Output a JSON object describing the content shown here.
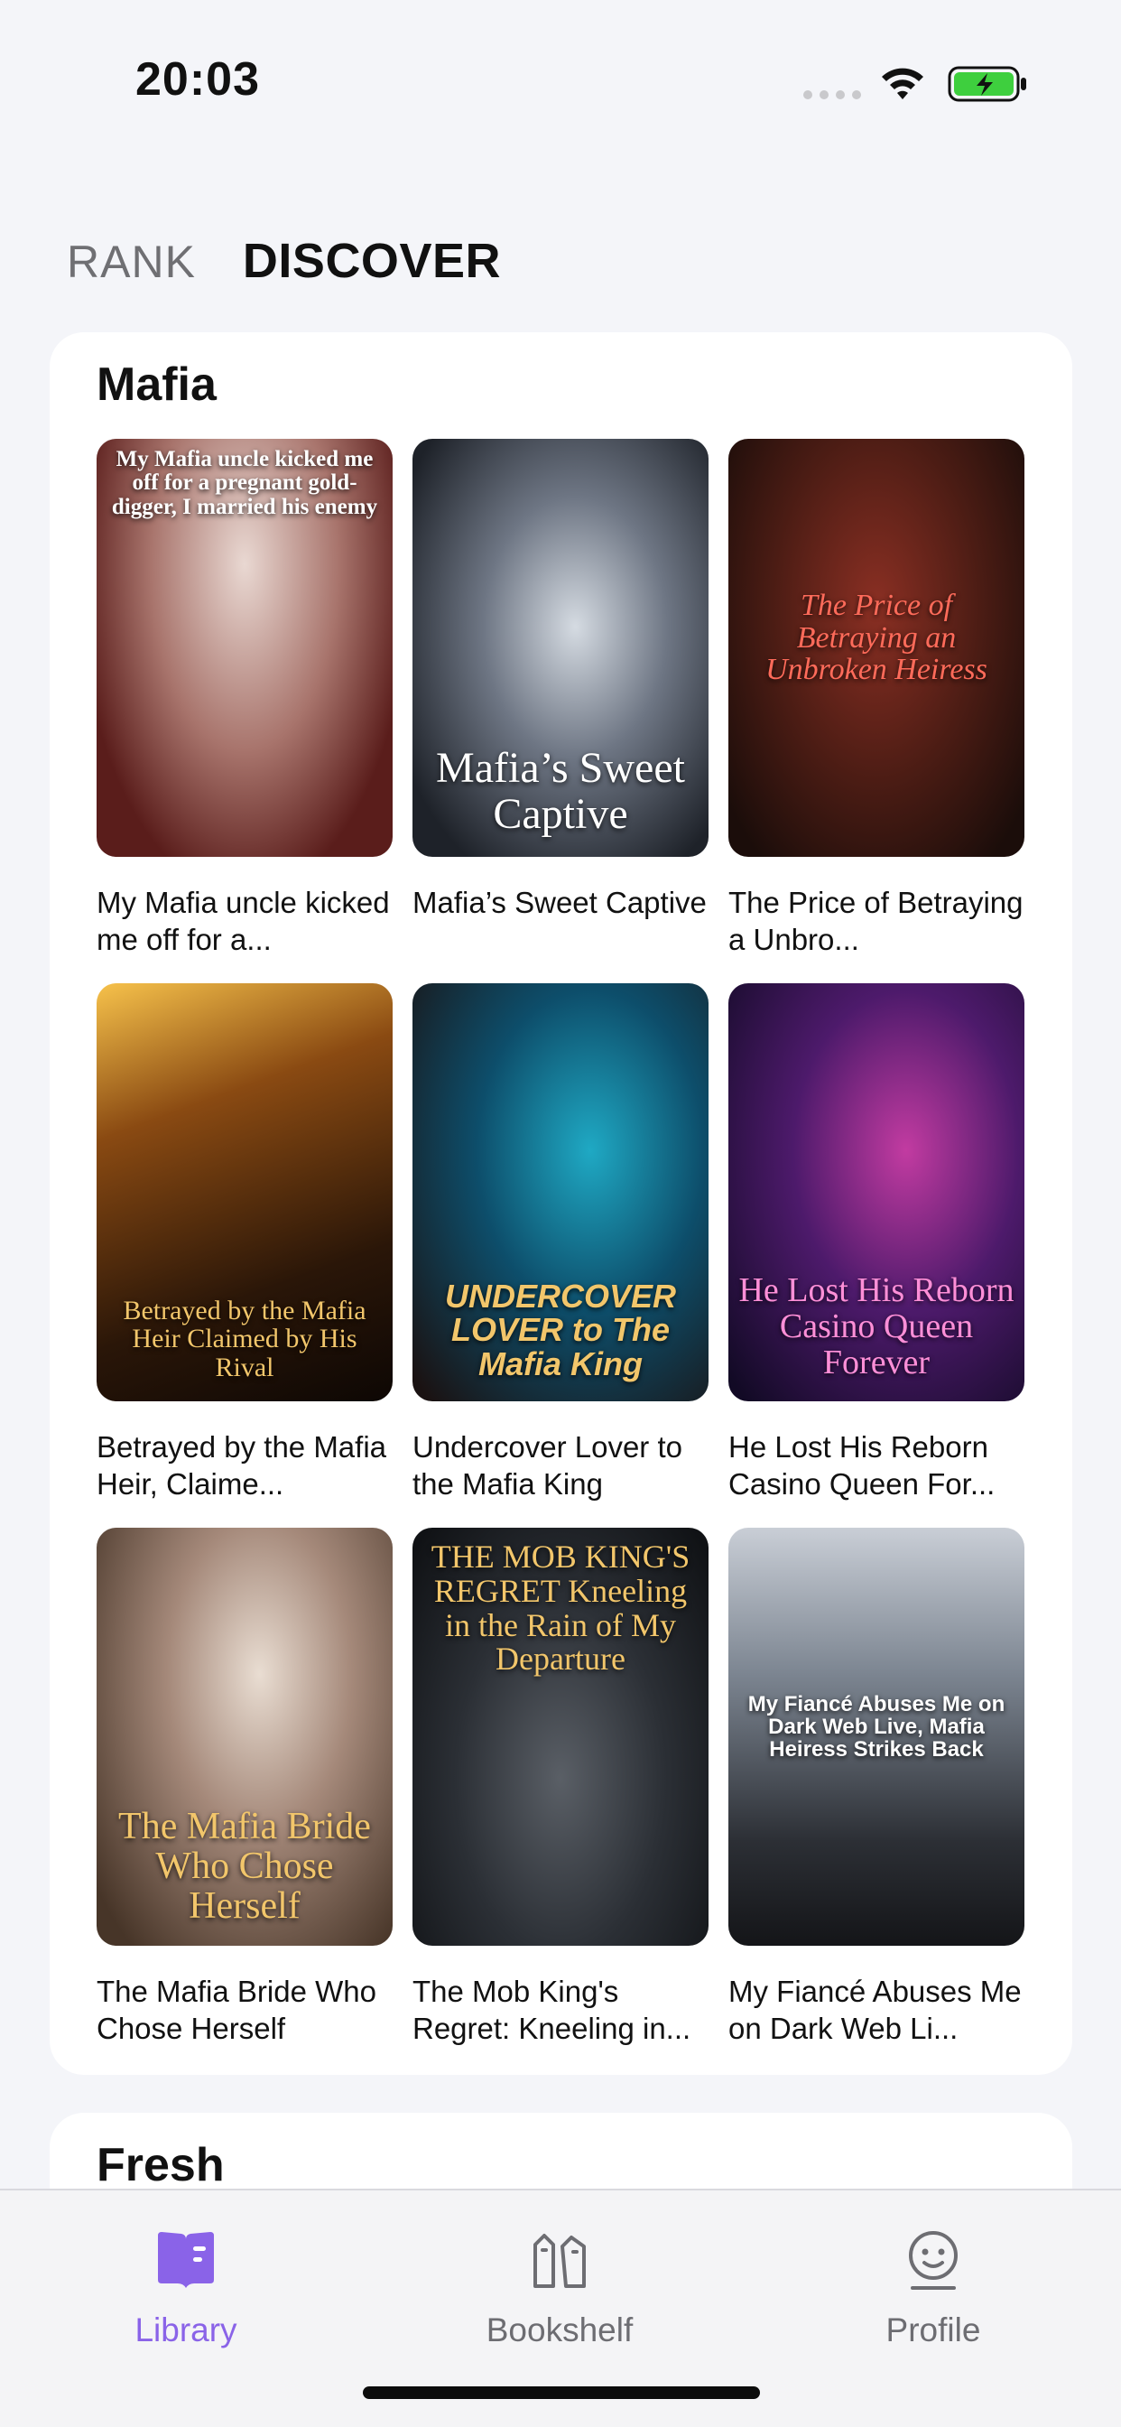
{
  "status_bar": {
    "time": "20:03"
  },
  "tabs": {
    "rank": "RANK",
    "discover": "DISCOVER"
  },
  "sections": {
    "mafia": {
      "title": "Mafia",
      "books": [
        {
          "title": "My Mafia uncle kicked me off for a...",
          "cover_text": "My Mafia uncle kicked me off for a pregnant gold-digger, I married his enemy"
        },
        {
          "title": "Mafia’s Sweet Captive",
          "cover_text": "Mafia’s Sweet Captive"
        },
        {
          "title": "The Price of Betraying a Unbro...",
          "cover_text": "The Price of Betraying an Unbroken Heiress"
        },
        {
          "title": "Betrayed by the Mafia Heir, Claime...",
          "cover_text": "Betrayed by the Mafia Heir Claimed by His Rival"
        },
        {
          "title": "Undercover Lover to the Mafia King",
          "cover_text": "UNDERCOVER LOVER to The Mafia King"
        },
        {
          "title": "He Lost His Reborn Casino Queen For...",
          "cover_text": "He Lost His Reborn Casino Queen Forever"
        },
        {
          "title": "The Mafia Bride Who Chose Herself",
          "cover_text": "The Mafia Bride Who Chose Herself"
        },
        {
          "title": "The Mob King's Regret: Kneeling in...",
          "cover_text": "THE MOB KING'S REGRET Kneeling in the Rain of My Departure"
        },
        {
          "title": "My Fiancé Abuses Me on Dark Web Li...",
          "cover_text": "My Fiancé Abuses Me on Dark Web Live, Mafia Heiress Strikes Back"
        }
      ]
    },
    "fresh": {
      "title": "Fresh"
    }
  },
  "bottom_nav": {
    "library": "Library",
    "bookshelf": "Bookshelf",
    "profile": "Profile"
  },
  "colors": {
    "accent": "#8a63e8",
    "background": "#f4f5f9",
    "battery": "#3ecf3e"
  },
  "icons": {
    "status": [
      "wifi-icon",
      "battery-charging-icon"
    ],
    "nav": [
      "library-book-icon",
      "bookshelf-icon",
      "profile-face-icon"
    ]
  }
}
